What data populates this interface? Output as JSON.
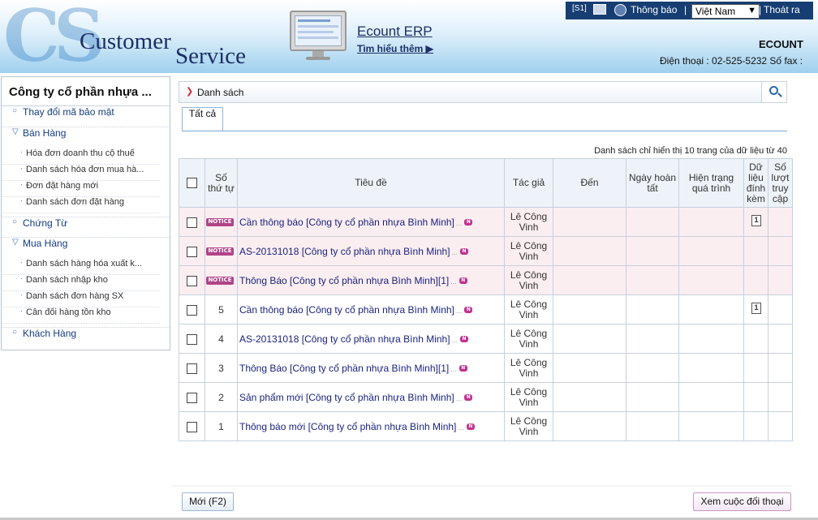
{
  "header": {
    "logo_prefix": "CS",
    "logo_word1": "Customer",
    "logo_word2": "Service",
    "product_title": "Ecount ERP",
    "learn_more": "Tìm hiểu thêm ▶",
    "company_code": "ECOUNT",
    "contact": "Điện thoại : 02-525-5232 Số fax :"
  },
  "topbar": {
    "code": "[S1]",
    "notifications_label": "Thông báo",
    "separator": "|",
    "language_selected": "Việt Nam",
    "logout_label": "Thoát ra"
  },
  "sidebar": {
    "company_name": "Công ty cổ phần nhựa ...",
    "change_password": "Thay đổi mã bảo mật",
    "sales": {
      "label": "Bán Hàng",
      "items": [
        "Hóa đơn doanh thu cộ thuế",
        "Danh sách hóa đơn mua hà...",
        "Đơn đặt hàng mới",
        "Danh sách đơn đặt hàng"
      ]
    },
    "vouchers": "Chứng Từ",
    "purchasing": {
      "label": "Mua Hàng",
      "items": [
        "Danh sách hàng hóa xuất k...",
        "Danh sách nhập kho",
        "Danh sách đơn hàng SX",
        "Cân đối hàng tồn kho"
      ]
    },
    "customers": "Khách Hàng"
  },
  "main": {
    "section_title": "Danh sách",
    "tab_all": "Tất cả",
    "list_info": "Danh sách chỉ hiển thị 10 trang của dữ liệu từ 40",
    "columns": {
      "no": "Số thứ tự",
      "title": "Tiêu đề",
      "author": "Tác giả",
      "to": "Đến",
      "done_date": "Ngày hoàn tất",
      "progress": "Hiện trạng quá trình",
      "attachment": "Dữ liệu đính kèm",
      "views": "Số lượt truy cập"
    },
    "notice_badge": "NOTICE",
    "new_badge": "N",
    "ellipsis": "...",
    "rows": [
      {
        "no": "",
        "notice": true,
        "title": "Cần thông báo [Công ty cổ phần nhựa Bình Minh]",
        "author": "Lê Công Vinh",
        "attachment": true
      },
      {
        "no": "",
        "notice": true,
        "title": "AS-20131018 [Công ty cổ phần nhựa Bình Minh]",
        "author": "Lê Công Vinh",
        "attachment": false
      },
      {
        "no": "",
        "notice": true,
        "title": "Thông Báo [Công ty cổ phần nhựa Bình Minh][1]",
        "author": "Lê Công Vinh",
        "attachment": false
      },
      {
        "no": "5",
        "notice": false,
        "title": "Cần thông báo [Công ty cổ phần nhựa Bình Minh]",
        "author": "Lê Công Vinh",
        "attachment": true
      },
      {
        "no": "4",
        "notice": false,
        "title": "AS-20131018 [Công ty cổ phần nhựa Bình Minh]",
        "author": "Lê Công Vinh",
        "attachment": false
      },
      {
        "no": "3",
        "notice": false,
        "title": "Thông Báo [Công ty cổ phần nhựa Bình Minh][1]",
        "author": "Lê Công Vinh",
        "attachment": false
      },
      {
        "no": "2",
        "notice": false,
        "title": "Sản phẩm mới [Công ty cổ phần nhựa Bình Minh]",
        "author": "Lê Công Vinh",
        "attachment": false
      },
      {
        "no": "1",
        "notice": false,
        "title": "Thông báo mới [Công ty cổ phần nhựa Bình Minh]",
        "author": "Lê Công Vinh",
        "attachment": false
      }
    ]
  },
  "footer": {
    "new_button": "Mới (F2)",
    "view_chat_button": "Xem cuộc đối thoại"
  },
  "colors": {
    "topbar_bg": "#163e73",
    "notice_row_bg": "#fbeef1",
    "notice_badge": "#b04488",
    "link": "#1a237e"
  }
}
